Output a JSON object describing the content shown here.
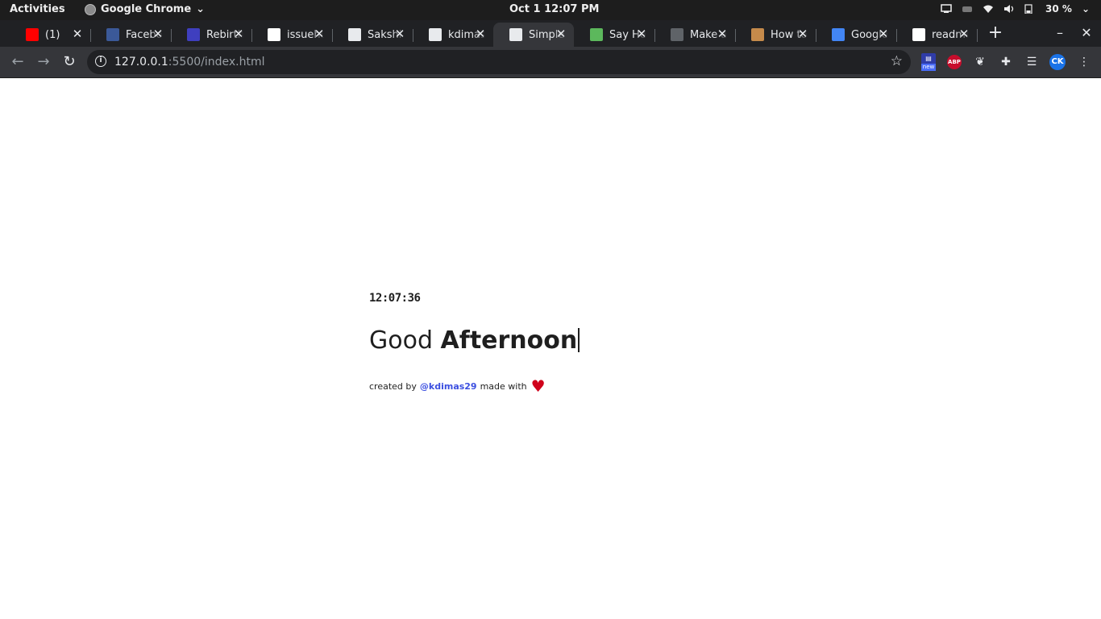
{
  "topbar": {
    "activities": "Activities",
    "app_name": "Google Chrome",
    "clock": "Oct 1  12:07 PM",
    "battery": "30 %"
  },
  "tabs": [
    {
      "title": "(1)",
      "favicon": "youtube-icon",
      "color": "#ff0000"
    },
    {
      "title": "Facebook",
      "favicon": "facebook-icon",
      "color": "#3b5998"
    },
    {
      "title": "Rebirth",
      "favicon": "kc-icon",
      "color": "#3f3fbf"
    },
    {
      "title": "issuehunt",
      "favicon": "issuehunt-icon",
      "color": "#ffffff"
    },
    {
      "title": "Sakshi",
      "favicon": "github-icon",
      "color": "#e8eaed"
    },
    {
      "title": "kdimas",
      "favicon": "github-icon",
      "color": "#e8eaed"
    },
    {
      "title": "Simple",
      "favicon": "globe-icon",
      "color": "#e8eaed",
      "active": true
    },
    {
      "title": "Say Hello",
      "favicon": "d-icon",
      "color": "#5cb85c"
    },
    {
      "title": "Make a",
      "favicon": "doc-icon",
      "color": "#5f6368"
    },
    {
      "title": "How to",
      "favicon": "meerkat-icon",
      "color": "#c58a4b"
    },
    {
      "title": "Google",
      "favicon": "google-translate-icon",
      "color": "#4285f4"
    },
    {
      "title": "readme",
      "favicon": "google-icon",
      "color": "#ffffff"
    }
  ],
  "omnibox": {
    "url_host": "127.0.0.1",
    "url_rest": ":5500/index.html"
  },
  "page": {
    "time": "12:07:36",
    "greeting_word": "Good",
    "greeting_period": "Afternoon",
    "credit_prefix": "created by",
    "credit_handle": "@kdimas29",
    "credit_suffix": "made with",
    "heart": "♥"
  },
  "colors": {
    "link": "#3b4fe0",
    "heart": "#d0021b",
    "chrome_dark": "#202124",
    "chrome_toolbar": "#35363a"
  }
}
